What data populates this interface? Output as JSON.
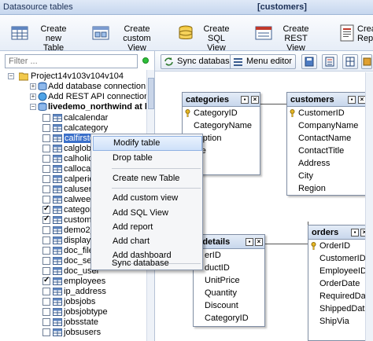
{
  "window": {
    "title": "Datasource tables",
    "context": "[customers]"
  },
  "toolbar": [
    {
      "name": "create-new-table-button",
      "label": "Create new\nTable"
    },
    {
      "name": "create-custom-view-button",
      "label": "Create custom\nView"
    },
    {
      "name": "create-sql-view-button",
      "label": "Create SQL\nView"
    },
    {
      "name": "create-rest-view-button",
      "label": "Create REST\nView"
    },
    {
      "name": "create-report-button",
      "label": "Create\nRepo"
    }
  ],
  "filter": {
    "placeholder": "Filter ..."
  },
  "tree": {
    "project": "Project14v103v104v104",
    "add_db": "Add database connection",
    "add_rest": "Add REST API connection",
    "connection": "livedemo_northwind at loca",
    "tables": [
      {
        "label": "calcalendar",
        "checked": false
      },
      {
        "label": "calcategory",
        "checked": false
      },
      {
        "label": "calfirstda",
        "checked": false,
        "selected": true
      },
      {
        "label": "calglobal",
        "checked": false
      },
      {
        "label": "calholida",
        "checked": false
      },
      {
        "label": "callocale",
        "checked": false
      },
      {
        "label": "calperiod",
        "checked": false
      },
      {
        "label": "calusers",
        "checked": false
      },
      {
        "label": "calweekd",
        "checked": false
      },
      {
        "label": "categorie",
        "checked": true
      },
      {
        "label": "customer",
        "checked": true
      },
      {
        "label": "demo2_a",
        "checked": false
      },
      {
        "label": "displaytt",
        "checked": false
      },
      {
        "label": "doc_files",
        "checked": false
      },
      {
        "label": "doc_sett",
        "checked": false
      },
      {
        "label": "doc_user",
        "checked": false
      },
      {
        "label": "employees",
        "checked": true
      },
      {
        "label": "ip_address",
        "checked": false
      },
      {
        "label": "jobsjobs",
        "checked": false
      },
      {
        "label": "jobsjobtype",
        "checked": false
      },
      {
        "label": "jobsstate",
        "checked": false
      },
      {
        "label": "jobsusers",
        "checked": false
      }
    ]
  },
  "designer": {
    "sync_label": "Sync database",
    "menu_label": "Menu editor"
  },
  "tables": {
    "categories": {
      "title": "categories",
      "fields": [
        "CategoryID",
        "CategoryName",
        "cription",
        "ure"
      ]
    },
    "customers": {
      "title": "customers",
      "fields": [
        "CustomerID",
        "CompanyName",
        "ContactName",
        "ContactTitle",
        "Address",
        "City",
        "Region"
      ]
    },
    "order_details": {
      "title": "r details",
      "fields": [
        "erID",
        "ductID",
        "UnitPrice",
        "Quantity",
        "Discount",
        "CategoryID"
      ]
    },
    "orders": {
      "title": "orders",
      "fields": [
        "OrderID",
        "CustomerID",
        "EmployeeID",
        "OrderDate",
        "RequiredDate",
        "ShippedDate",
        "ShipVia"
      ]
    }
  },
  "context_menu": {
    "items": [
      "Modify table",
      "Drop table",
      "Create new Table",
      "Add custom view",
      "Add SQL View",
      "Add report",
      "Add chart",
      "Add dashboard",
      "Sync database"
    ]
  }
}
